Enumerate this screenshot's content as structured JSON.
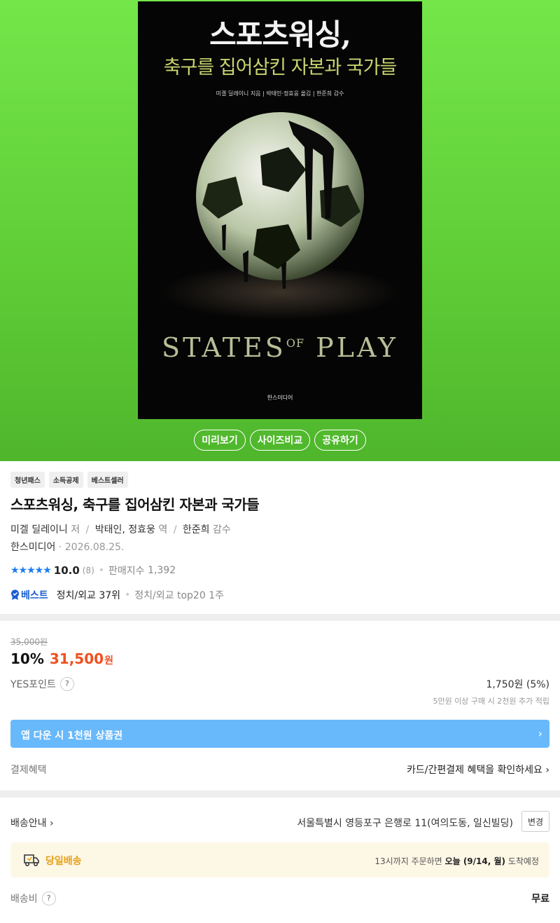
{
  "cover": {
    "title": "스포츠워싱,",
    "subtitle": "축구를 집어삼킨 자본과 국가들",
    "credits": "미겔 딜레이니 지음 | 박태인·정효웅 옮김 | 한준희 감수",
    "states": "STATES",
    "of": "OF",
    "play": "PLAY",
    "publisher": "한스미디어"
  },
  "hero_buttons": {
    "preview": "미리보기",
    "size_compare": "사이즈비교",
    "share": "공유하기"
  },
  "tags": [
    "청년패스",
    "소득공제",
    "베스트셀러"
  ],
  "product": {
    "title": "스포츠워싱, 축구를 집어삼킨 자본과 국가들",
    "author": "미겔 딜레이니",
    "author_role": "저",
    "translators": "박태인, 정효웅",
    "translator_role": "역",
    "supervisor": "한준희",
    "supervisor_role": "감수",
    "publisher": "한스미디어",
    "date": "2026.08.25."
  },
  "rating": {
    "stars": "★★★★★",
    "score": "10.0",
    "count": "(8)",
    "sales_label": "판매지수",
    "sales_value": "1,392"
  },
  "best": {
    "badge": "베스트",
    "rank": "정치/외교 37위",
    "weeks": "정치/외교 top20 1주"
  },
  "price": {
    "original": "35,000원",
    "discount": "10%",
    "amount": "31,500",
    "unit": "원",
    "yes_point_label": "YES포인트",
    "yes_point_value": "1,750원 (5%)",
    "point_note": "5만원 이상 구매 시 2천원 추가 적립",
    "banner": "앱 다운 시 1천원 상품권",
    "payment_label": "결제혜택",
    "payment_link": "카드/간편결제 혜택을 확인하세요"
  },
  "delivery": {
    "label": "배송안내",
    "address": "서울특별시 영등포구 은행로 11(여의도동, 일신빌딩)",
    "change": "변경",
    "sameday_label": "당일배송",
    "sameday_prefix": "13시까지 주문하면",
    "sameday_date": "오늘 (9/14, 월)",
    "sameday_suffix": "도착예정",
    "fee_label": "배송비",
    "fee_value": "무료"
  },
  "colors": {
    "hero_green": "#6bd945",
    "price_orange": "#f05020",
    "banner_blue": "#68b9fb",
    "star_blue": "#1a7cf0",
    "sameday_gold": "#e5a11a"
  }
}
